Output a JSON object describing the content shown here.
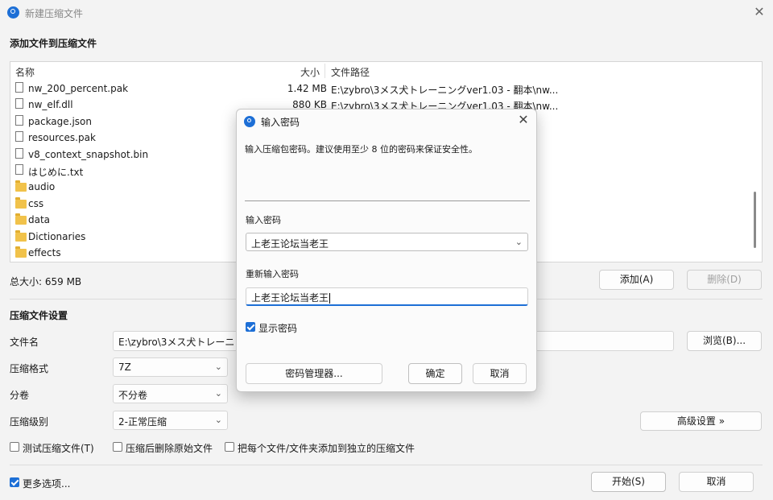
{
  "window": {
    "title": "新建压缩文件"
  },
  "add_section": {
    "title": "添加文件到压缩文件"
  },
  "file_list": {
    "columns": {
      "name": "名称",
      "size": "大小",
      "path": "文件路径"
    },
    "rows": [
      {
        "name": "nw_200_percent.pak",
        "size": "1.42 MB",
        "path": "E:\\zybro\\3メス犬トレーニングver1.03 - 翻本\\nw...",
        "type": "file"
      },
      {
        "name": "nw_elf.dll",
        "size": "880 KB",
        "path": "E:\\zybro\\3メス犬トレーニングver1.03 - 翻本\\nw...",
        "type": "file"
      },
      {
        "name": "package.json",
        "size": "",
        "path": "",
        "type": "file"
      },
      {
        "name": "resources.pak",
        "size": "",
        "path": "",
        "type": "file"
      },
      {
        "name": "v8_context_snapshot.bin",
        "size": "",
        "path": "",
        "type": "file"
      },
      {
        "name": "はじめに.txt",
        "size": "",
        "path": "",
        "type": "file"
      },
      {
        "name": "audio",
        "size": "",
        "path": "",
        "type": "folder"
      },
      {
        "name": "css",
        "size": "",
        "path": "",
        "type": "folder"
      },
      {
        "name": "data",
        "size": "",
        "path": "",
        "type": "folder"
      },
      {
        "name": "Dictionaries",
        "size": "",
        "path": "",
        "type": "folder"
      },
      {
        "name": "effects",
        "size": "",
        "path": "",
        "type": "folder"
      }
    ]
  },
  "total_size": "总大小: 659 MB",
  "buttons": {
    "add": "添加(A)",
    "delete": "删除(D)",
    "browse": "浏览(B)...",
    "advanced": "高级设置 »",
    "start": "开始(S)",
    "cancel": "取消"
  },
  "settings": {
    "title": "压缩文件设置",
    "filename_label": "文件名",
    "filename_value": "E:\\zybro\\3メス犬トレーニン",
    "format_label": "压缩格式",
    "format_value": "7Z",
    "split_label": "分卷",
    "split_value": "不分卷",
    "level_label": "压缩级别",
    "level_value": "2-正常压缩"
  },
  "checkboxes": {
    "test": "测试压缩文件(T)",
    "delete_source": "压缩后删除原始文件",
    "separate": "把每个文件/文件夹添加到独立的压缩文件",
    "more_options": "更多选项..."
  },
  "modal": {
    "title": "输入密码",
    "description": "输入压缩包密码。建议使用至少 8 位的密码来保证安全性。",
    "password_label": "输入密码",
    "password_value": "上老王论坛当老王",
    "reenter_label": "重新输入密码",
    "reenter_value": "上老王论坛当老王",
    "show_password": "显示密码",
    "manager_button": "密码管理器...",
    "ok_button": "确定",
    "cancel_button": "取消"
  },
  "colors": {
    "accent": "#1d6fd6",
    "folder": "#f1c24a"
  }
}
